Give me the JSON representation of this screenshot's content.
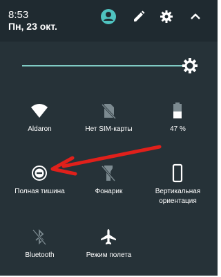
{
  "status": {
    "time": "8:53",
    "date": "Пн, 23 окт."
  },
  "header_icons": [
    "account-icon",
    "edit-pencil-icon",
    "settings-gear-icon",
    "collapse-chevron-up-icon"
  ],
  "brightness": {
    "level": 0.95,
    "icon": "brightness-auto-icon",
    "track_color": "#80cbc4"
  },
  "tiles": [
    {
      "label": "Aldaron",
      "icon": "wifi-icon",
      "active": true
    },
    {
      "label": "Нет SIM-карты",
      "icon": "no-sim-icon",
      "active": false
    },
    {
      "label": "47 %",
      "icon": "battery-icon",
      "active": false
    },
    {
      "label": "Полная тишина",
      "icon": "do-not-disturb-icon",
      "active": true
    },
    {
      "label": "Фонарик",
      "icon": "flashlight-off-icon",
      "active": false
    },
    {
      "label": "Вертикальная ориентация",
      "icon": "phone-portrait-icon",
      "active": true
    },
    {
      "label": "Bluetooth",
      "icon": "bluetooth-off-icon",
      "active": false
    },
    {
      "label": "Режим полета",
      "icon": "airplane-icon",
      "active": true
    }
  ],
  "annotation": {
    "type": "red-arrow",
    "color": "#e0201b",
    "points_to": "Полная тишина"
  },
  "colors": {
    "panel_bg": "#263238",
    "header_bg": "#1f2a30",
    "accent": "#4fc3c0",
    "icon_inactive": "#7c8a90"
  }
}
